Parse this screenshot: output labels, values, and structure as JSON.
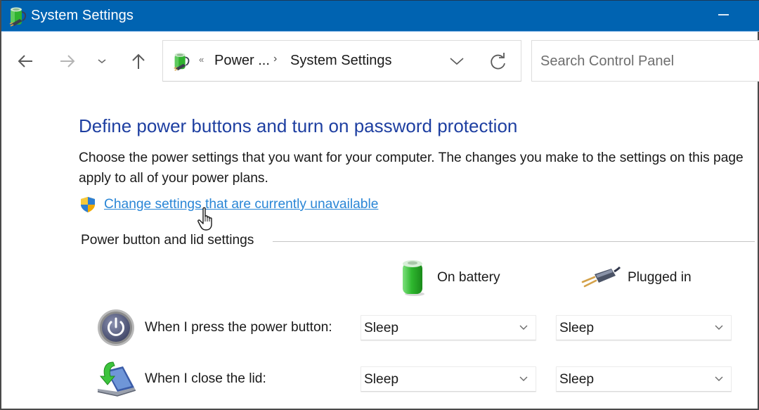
{
  "window": {
    "title": "System Settings",
    "icon": "power-options-icon",
    "controls": {
      "minimize": "minimize-icon"
    }
  },
  "toolbar": {
    "back": "arrow-left-icon",
    "forward": "arrow-right-icon",
    "recent": "chevron-down-icon",
    "up": "arrow-up-icon",
    "address": {
      "icon": "power-options-icon",
      "overflow": "«",
      "breadcrumbs": [
        {
          "label": "Power ..."
        },
        {
          "label": "System Settings"
        }
      ],
      "separator": "›",
      "dropdown": "chevron-down-icon",
      "refresh": "refresh-icon"
    },
    "search": {
      "placeholder": "Search Control Panel",
      "value": ""
    }
  },
  "main": {
    "title": "Define power buttons and turn on password protection",
    "description": "Choose the power settings that you want for your computer. The changes you make to the settings on this page apply to all of your power plans.",
    "admin_link": {
      "icon": "uac-shield-icon",
      "label": "Change settings that are currently unavailable"
    },
    "section": {
      "label": "Power button and lid settings",
      "columns": [
        {
          "label": "On battery",
          "icon": "battery-icon"
        },
        {
          "label": "Plugged in",
          "icon": "power-plug-icon"
        }
      ],
      "rows": [
        {
          "label": "When I press the power button:",
          "icon": "power-button-icon",
          "on_battery": "Sleep",
          "plugged_in": "Sleep"
        },
        {
          "label": "When I close the lid:",
          "icon": "laptop-lid-icon",
          "on_battery": "Sleep",
          "plugged_in": "Sleep"
        }
      ]
    }
  },
  "colors": {
    "titlebar": "#0063b1",
    "heading": "#1e3fa1",
    "link": "#2a86d6"
  }
}
